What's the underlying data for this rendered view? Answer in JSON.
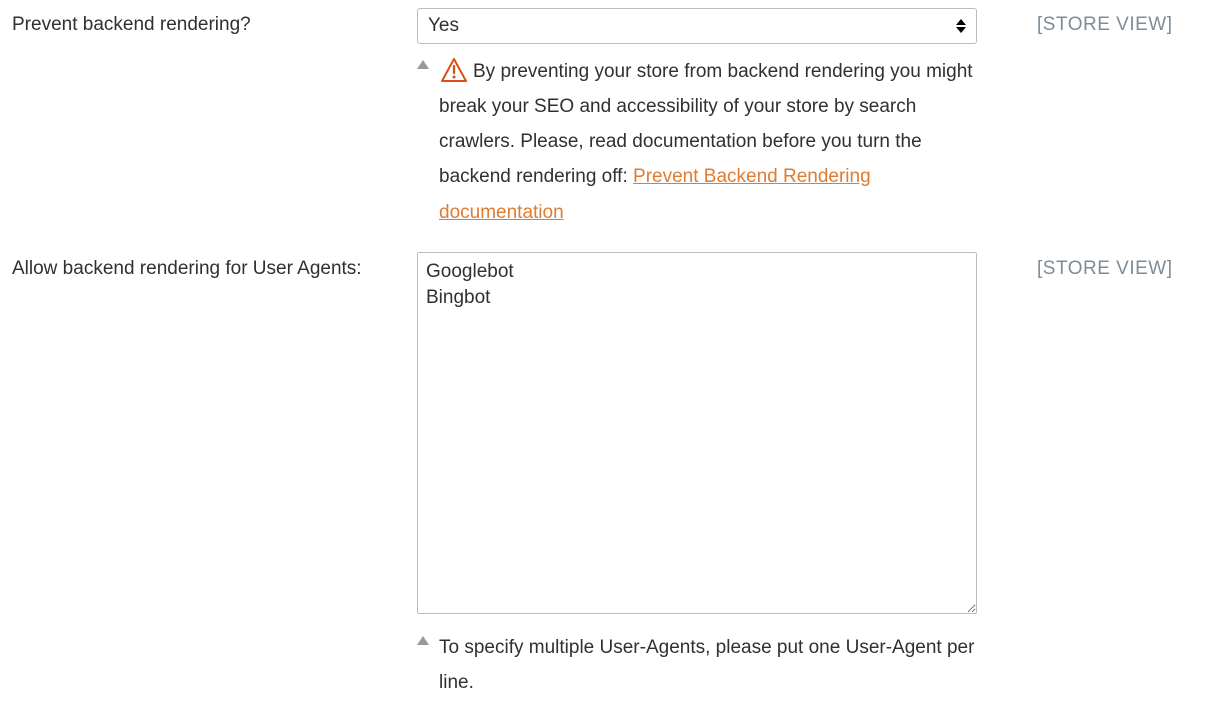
{
  "fields": {
    "prevent": {
      "label": "Prevent backend rendering?",
      "value": "Yes",
      "scope": "[STORE VIEW]",
      "warning_text": "By preventing your store from backend rendering you might break your SEO and accessibility of your store by search crawlers. Please, read documentation before you turn the backend rendering off: ",
      "warning_link_text": "Prevent Backend Rendering documentation"
    },
    "agents": {
      "label": "Allow backend rendering for User Agents:",
      "value": "Googlebot\nBingbot",
      "scope": "[STORE VIEW]",
      "hint": "To specify multiple User-Agents, please put one User-Agent per line."
    }
  }
}
